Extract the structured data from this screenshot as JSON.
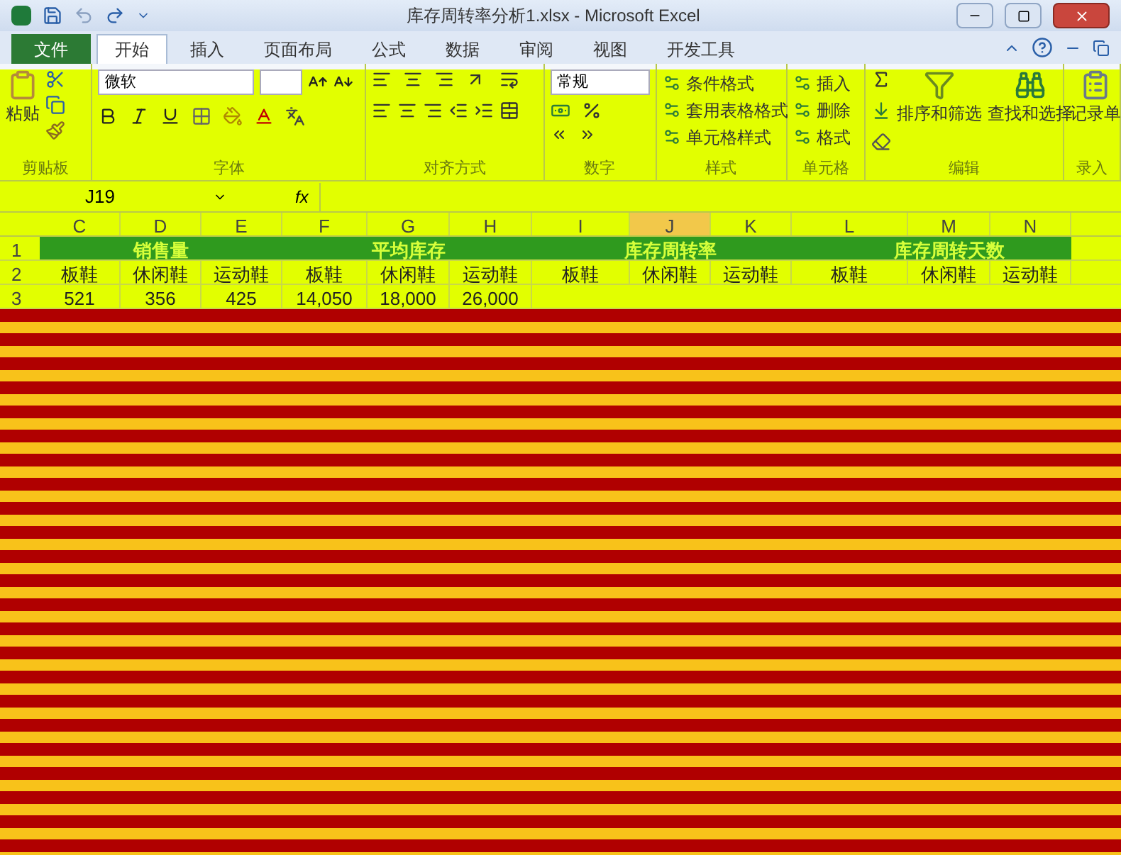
{
  "title_bar": {
    "title": "库存周转率分析1.xlsx - Microsoft Excel"
  },
  "tabs": [
    {
      "label": "文件",
      "kind": "file",
      "selected": false
    },
    {
      "label": "开始",
      "kind": "tab",
      "selected": true
    },
    {
      "label": "插入",
      "kind": "tab",
      "selected": false
    },
    {
      "label": "页面布局",
      "kind": "tab",
      "selected": false
    },
    {
      "label": "公式",
      "kind": "tab",
      "selected": false
    },
    {
      "label": "数据",
      "kind": "tab",
      "selected": false
    },
    {
      "label": "审阅",
      "kind": "tab",
      "selected": false
    },
    {
      "label": "视图",
      "kind": "tab",
      "selected": false
    },
    {
      "label": "开发工具",
      "kind": "tab",
      "selected": false
    }
  ],
  "ribbon": {
    "groups": [
      "剪贴板",
      "字体",
      "对齐方式",
      "数字",
      "样式",
      "单元格",
      "编辑",
      "录入"
    ],
    "paste": "粘贴",
    "font_name": "微软",
    "number_format": "常规",
    "styles": [
      "条件格式",
      "套用表格格式",
      "单元格样式"
    ],
    "cells": [
      "插入",
      "删除",
      "格式"
    ],
    "sort_filter": "排序和筛选",
    "find_select": "查找和选择",
    "record_form": "记录单"
  },
  "formula_bar": {
    "name_box": "J19",
    "fx": "fx"
  },
  "sheet": {
    "columns": [
      {
        "label": "C",
        "selected": false
      },
      {
        "label": "D",
        "selected": false
      },
      {
        "label": "E",
        "selected": false
      },
      {
        "label": "F",
        "selected": false
      },
      {
        "label": "G",
        "selected": false
      },
      {
        "label": "H",
        "selected": false
      },
      {
        "label": "I",
        "selected": false
      },
      {
        "label": "J",
        "selected": true
      },
      {
        "label": "K",
        "selected": false
      },
      {
        "label": "L",
        "selected": false
      },
      {
        "label": "M",
        "selected": false
      },
      {
        "label": "N",
        "selected": false
      }
    ],
    "rows": [
      {
        "header": "1",
        "kind": "merged",
        "cells": [
          "",
          "销售量",
          "",
          "",
          "平均库存",
          "",
          "",
          "库存周转率",
          "",
          "",
          "库存周转天数",
          ""
        ]
      },
      {
        "header": "2",
        "kind": "plain",
        "cells": [
          "板鞋",
          "休闲鞋",
          "运动鞋",
          "板鞋",
          "休闲鞋",
          "运动鞋",
          "板鞋",
          "休闲鞋",
          "运动鞋",
          "板鞋",
          "休闲鞋",
          "运动鞋"
        ]
      },
      {
        "header": "3",
        "kind": "plain",
        "cells": [
          "521",
          "356",
          "425",
          "14,050",
          "18,000",
          "26,000"
        ]
      }
    ]
  }
}
